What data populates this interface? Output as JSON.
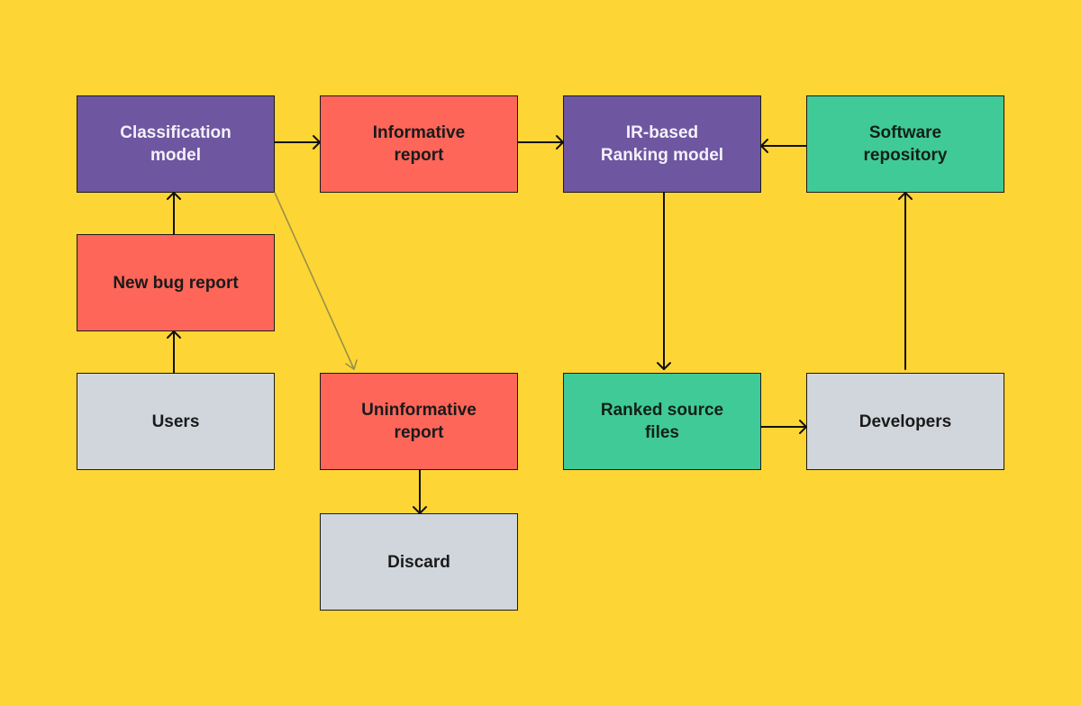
{
  "diagram": {
    "background_color": "#fdd535",
    "nodes": [
      {
        "id": "classification-model",
        "label": "Classification\nmodel",
        "fill": "#6e56a0"
      },
      {
        "id": "informative-report",
        "label": "Informative\nreport",
        "fill": "#fd6659"
      },
      {
        "id": "ir-ranking-model",
        "label": "IR-based\nRanking model",
        "fill": "#6e56a0"
      },
      {
        "id": "software-repository",
        "label": "Software\nrepository",
        "fill": "#40ca98"
      },
      {
        "id": "new-bug-report",
        "label": "New bug report",
        "fill": "#fd6659"
      },
      {
        "id": "users",
        "label": "Users",
        "fill": "#d1d6dd"
      },
      {
        "id": "uninformative-report",
        "label": "Uninformative\nreport",
        "fill": "#fd6659"
      },
      {
        "id": "ranked-source-files",
        "label": "Ranked source\nfiles",
        "fill": "#40ca98"
      },
      {
        "id": "developers",
        "label": "Developers",
        "fill": "#d1d6dd"
      },
      {
        "id": "discard",
        "label": "Discard",
        "fill": "#d1d6dd"
      }
    ],
    "edges": [
      {
        "from": "users",
        "to": "new-bug-report",
        "color": "#111111"
      },
      {
        "from": "new-bug-report",
        "to": "classification-model",
        "color": "#111111"
      },
      {
        "from": "classification-model",
        "to": "informative-report",
        "color": "#111111"
      },
      {
        "from": "classification-model",
        "to": "uninformative-report",
        "color": "#9a9048"
      },
      {
        "from": "informative-report",
        "to": "ir-ranking-model",
        "color": "#111111"
      },
      {
        "from": "software-repository",
        "to": "ir-ranking-model",
        "color": "#111111"
      },
      {
        "from": "ir-ranking-model",
        "to": "ranked-source-files",
        "color": "#111111"
      },
      {
        "from": "ranked-source-files",
        "to": "developers",
        "color": "#111111"
      },
      {
        "from": "developers",
        "to": "software-repository",
        "color": "#111111"
      },
      {
        "from": "uninformative-report",
        "to": "discard",
        "color": "#111111"
      }
    ]
  }
}
